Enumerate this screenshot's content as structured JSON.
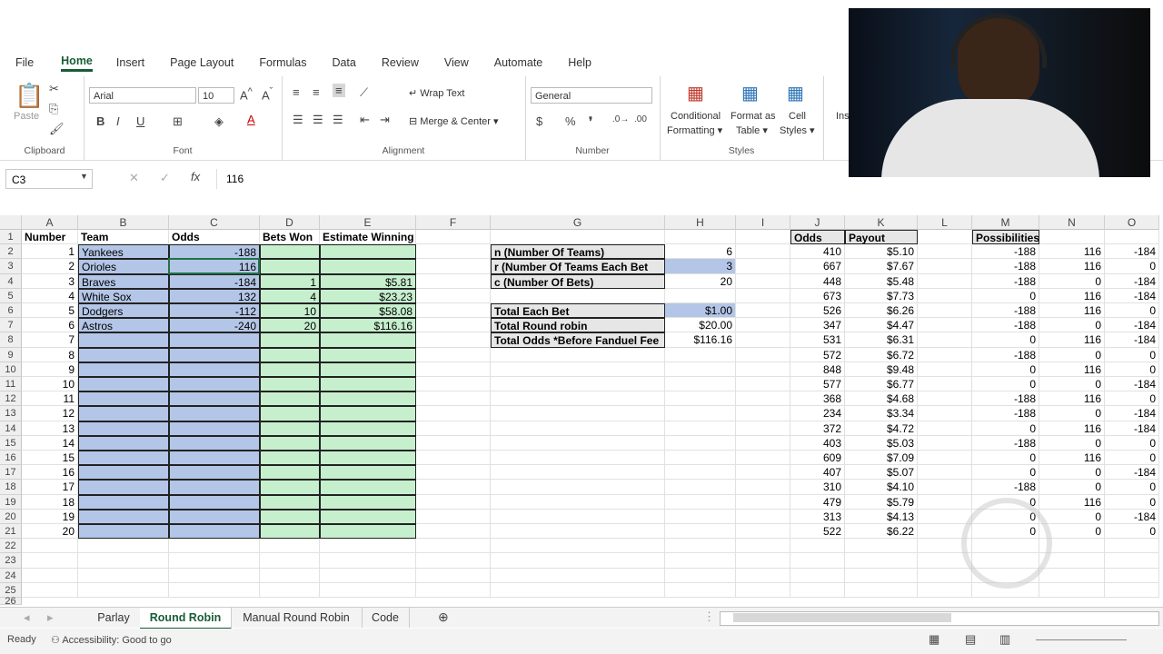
{
  "menu": [
    "File",
    "Home",
    "Insert",
    "Page Layout",
    "Formulas",
    "Data",
    "Review",
    "View",
    "Automate",
    "Help"
  ],
  "ribbon": {
    "clipboard": {
      "label": "Clipboard",
      "paste": "Paste"
    },
    "font": {
      "label": "Font",
      "name": "Arial",
      "size": "10"
    },
    "alignment": {
      "label": "Alignment",
      "wrap": "Wrap Text",
      "merge": "Merge & Center"
    },
    "number": {
      "label": "Number",
      "format": "General"
    },
    "styles": {
      "label": "Styles",
      "conditional": "Conditional",
      "formatting": "Formatting",
      "format_as": "Format as",
      "table": "Table",
      "cell": "Cell",
      "styles": "Styles"
    },
    "insert_partial": "Ins"
  },
  "formula_bar": {
    "name_box": "C3",
    "value": "116"
  },
  "columns": [
    "A",
    "B",
    "C",
    "D",
    "E",
    "F",
    "G",
    "H",
    "I",
    "J",
    "K",
    "L",
    "M",
    "N",
    "O"
  ],
  "rows": [
    "1",
    "2",
    "3",
    "4",
    "5",
    "6",
    "7",
    "8",
    "9",
    "10",
    "11",
    "12",
    "13",
    "14",
    "15",
    "16",
    "17",
    "18",
    "19",
    "20",
    "21",
    "22",
    "23",
    "24",
    "25",
    "26"
  ],
  "table_left": {
    "headers": [
      "Number",
      "Team",
      "Odds",
      "Bets Won",
      "Estimate Winning"
    ],
    "rows": [
      [
        "1",
        "Yankees",
        "-188",
        "",
        ""
      ],
      [
        "2",
        "Orioles",
        "116",
        "",
        ""
      ],
      [
        "3",
        "Braves",
        "-184",
        "1",
        "$5.81"
      ],
      [
        "4",
        "White Sox",
        "132",
        "4",
        "$23.23"
      ],
      [
        "5",
        "Dodgers",
        "-112",
        "10",
        "$58.08"
      ],
      [
        "6",
        "Astros",
        "-240",
        "20",
        "$116.16"
      ],
      [
        "7",
        "",
        "",
        "",
        ""
      ],
      [
        "8",
        "",
        "",
        "",
        ""
      ],
      [
        "9",
        "",
        "",
        "",
        ""
      ],
      [
        "10",
        "",
        "",
        "",
        ""
      ],
      [
        "11",
        "",
        "",
        "",
        ""
      ],
      [
        "12",
        "",
        "",
        "",
        ""
      ],
      [
        "13",
        "",
        "",
        "",
        ""
      ],
      [
        "14",
        "",
        "",
        "",
        ""
      ],
      [
        "15",
        "",
        "",
        "",
        ""
      ],
      [
        "16",
        "",
        "",
        "",
        ""
      ],
      [
        "17",
        "",
        "",
        "",
        ""
      ],
      [
        "18",
        "",
        "",
        "",
        ""
      ],
      [
        "19",
        "",
        "",
        "",
        ""
      ],
      [
        "20",
        "",
        "",
        "",
        ""
      ]
    ]
  },
  "params": [
    {
      "label": "n (Number Of Teams)",
      "value": "6"
    },
    {
      "label": "r (Number Of Teams Each Bet",
      "value": "3"
    },
    {
      "label": "c (Number Of Bets)",
      "value": "20"
    }
  ],
  "totals": [
    {
      "label": "Total Each Bet",
      "value": "$1.00"
    },
    {
      "label": "Total Round robin",
      "value": "$20.00"
    },
    {
      "label": "Total Odds *Before Fanduel Fee",
      "value": "$116.16"
    }
  ],
  "odds_table": {
    "headers": [
      "Odds",
      "Payout"
    ],
    "rows": [
      [
        "410",
        "$5.10"
      ],
      [
        "667",
        "$7.67"
      ],
      [
        "448",
        "$5.48"
      ],
      [
        "673",
        "$7.73"
      ],
      [
        "526",
        "$6.26"
      ],
      [
        "347",
        "$4.47"
      ],
      [
        "531",
        "$6.31"
      ],
      [
        "572",
        "$6.72"
      ],
      [
        "848",
        "$9.48"
      ],
      [
        "577",
        "$6.77"
      ],
      [
        "368",
        "$4.68"
      ],
      [
        "234",
        "$3.34"
      ],
      [
        "372",
        "$4.72"
      ],
      [
        "403",
        "$5.03"
      ],
      [
        "609",
        "$7.09"
      ],
      [
        "407",
        "$5.07"
      ],
      [
        "310",
        "$4.10"
      ],
      [
        "479",
        "$5.79"
      ],
      [
        "313",
        "$4.13"
      ],
      [
        "522",
        "$6.22"
      ]
    ]
  },
  "possibilities": {
    "header": "Possibilities",
    "rows": [
      [
        "-188",
        "116",
        "-184"
      ],
      [
        "-188",
        "116",
        "0"
      ],
      [
        "-188",
        "0",
        "-184"
      ],
      [
        "0",
        "116",
        "-184"
      ],
      [
        "-188",
        "116",
        "0"
      ],
      [
        "-188",
        "0",
        "-184"
      ],
      [
        "0",
        "116",
        "-184"
      ],
      [
        "-188",
        "0",
        "0"
      ],
      [
        "0",
        "116",
        "0"
      ],
      [
        "0",
        "0",
        "-184"
      ],
      [
        "-188",
        "116",
        "0"
      ],
      [
        "-188",
        "0",
        "-184"
      ],
      [
        "0",
        "116",
        "-184"
      ],
      [
        "-188",
        "0",
        "0"
      ],
      [
        "0",
        "116",
        "0"
      ],
      [
        "0",
        "0",
        "-184"
      ],
      [
        "-188",
        "0",
        "0"
      ],
      [
        "0",
        "116",
        "0"
      ],
      [
        "0",
        "0",
        "-184"
      ],
      [
        "0",
        "0",
        "0"
      ]
    ]
  },
  "sheet_tabs": [
    "Parlay",
    "Round Robin",
    "Manual Round Robin",
    "Code"
  ],
  "status": {
    "ready": "Ready",
    "accessibility": "Accessibility: Good to go"
  },
  "colors": {
    "blue": "#b4c6e7",
    "green": "#c6efce",
    "accent": "#185c37"
  }
}
